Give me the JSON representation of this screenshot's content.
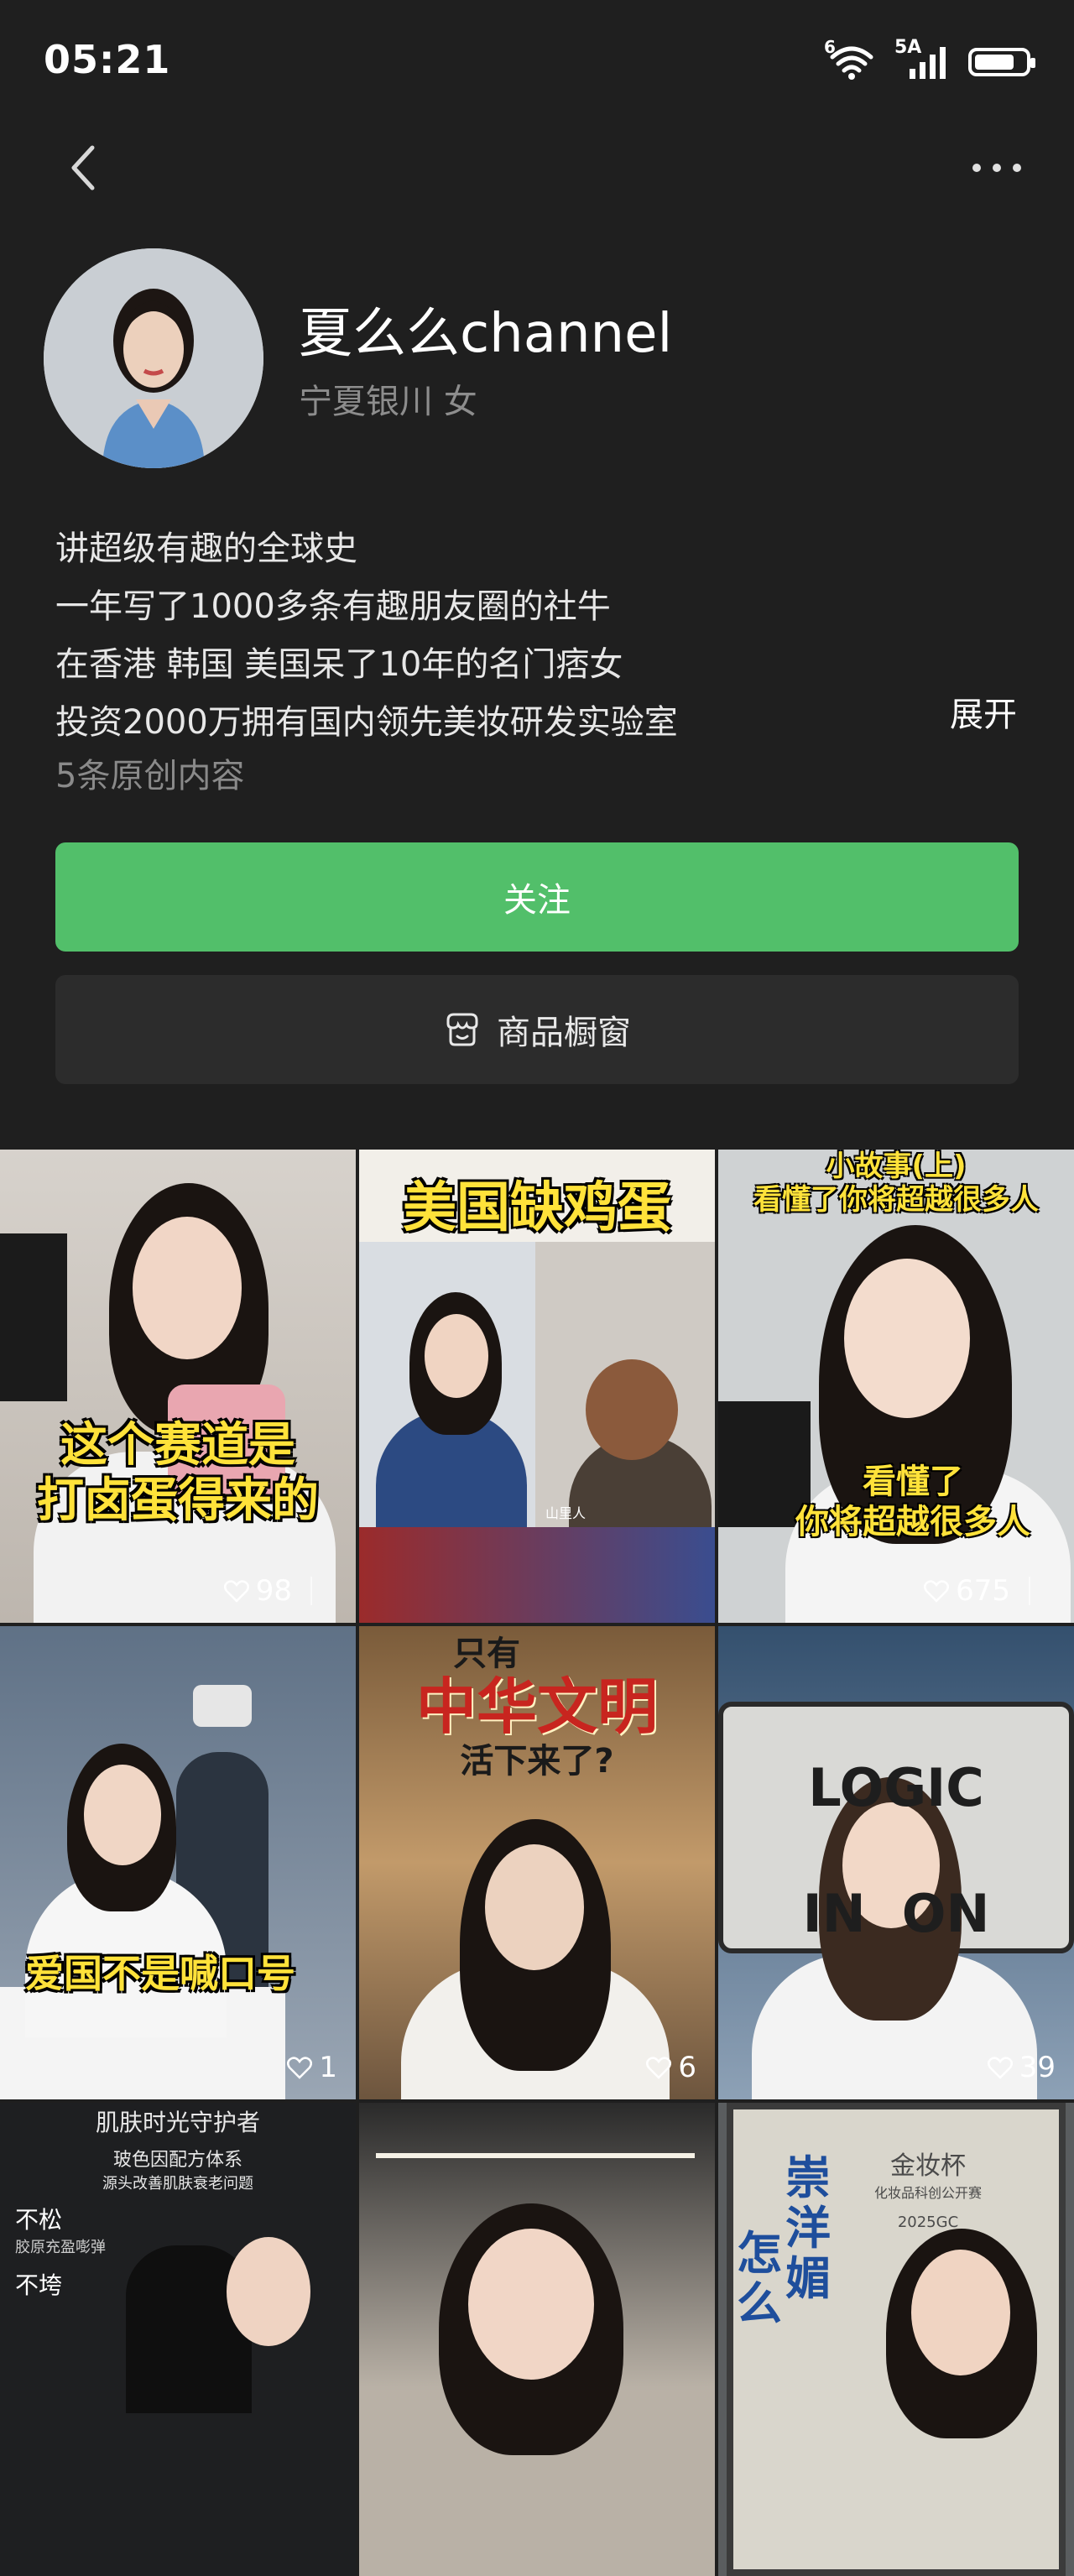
{
  "status_bar": {
    "time": "05:21",
    "network_label": "5A",
    "wifi_label": "6",
    "battery_percent": 80
  },
  "profile": {
    "name": "夏么么channel",
    "location": "宁夏银川 女",
    "bio_lines": [
      "讲超级有趣的全球史",
      "一年写了1000多条有趣朋友圈的社牛",
      "在香港 韩国 美国呆了10年的名门痞女",
      "投资2000万拥有国内领先美妆研发实验室"
    ],
    "expand_label": "展开",
    "original_count": "5条原创内容"
  },
  "actions": {
    "follow_label": "关注",
    "shop_label": "商品橱窗"
  },
  "videos": [
    {
      "caption_lines": [
        "这个赛道是",
        "打卤蛋得来的"
      ],
      "likes": "98"
    },
    {
      "caption_lines": [
        "美国缺鸡蛋"
      ],
      "sub_label": "山里人",
      "likes": ""
    },
    {
      "caption_lines": [
        "小故事(上)",
        "看懂了你将超越很多人"
      ],
      "overlay_lines": [
        "看懂了",
        "你将超越很多人"
      ],
      "likes": "675"
    },
    {
      "caption_lines": [
        "爱国不是喊口号"
      ],
      "likes": "1"
    },
    {
      "caption_lines": [
        "只有",
        "中华文明",
        "活下来了?"
      ],
      "likes": "6"
    },
    {
      "caption_lines": [
        "LOGIC",
        "IN  ON"
      ],
      "likes": "39"
    },
    {
      "caption_lines": [
        "肌肤时光守护者",
        "玻色因配方体系",
        "源头改善肌肤衰老问题",
        "不松",
        "胶原充盈嘭弹",
        "不垮"
      ],
      "likes": ""
    },
    {
      "caption_lines": [],
      "likes": ""
    },
    {
      "caption_lines": [
        "金妆杯",
        "化妆品科创公开赛",
        "2025GC",
        "崇",
        "洋",
        "媚",
        "怎",
        "么"
      ],
      "likes": ""
    }
  ]
}
